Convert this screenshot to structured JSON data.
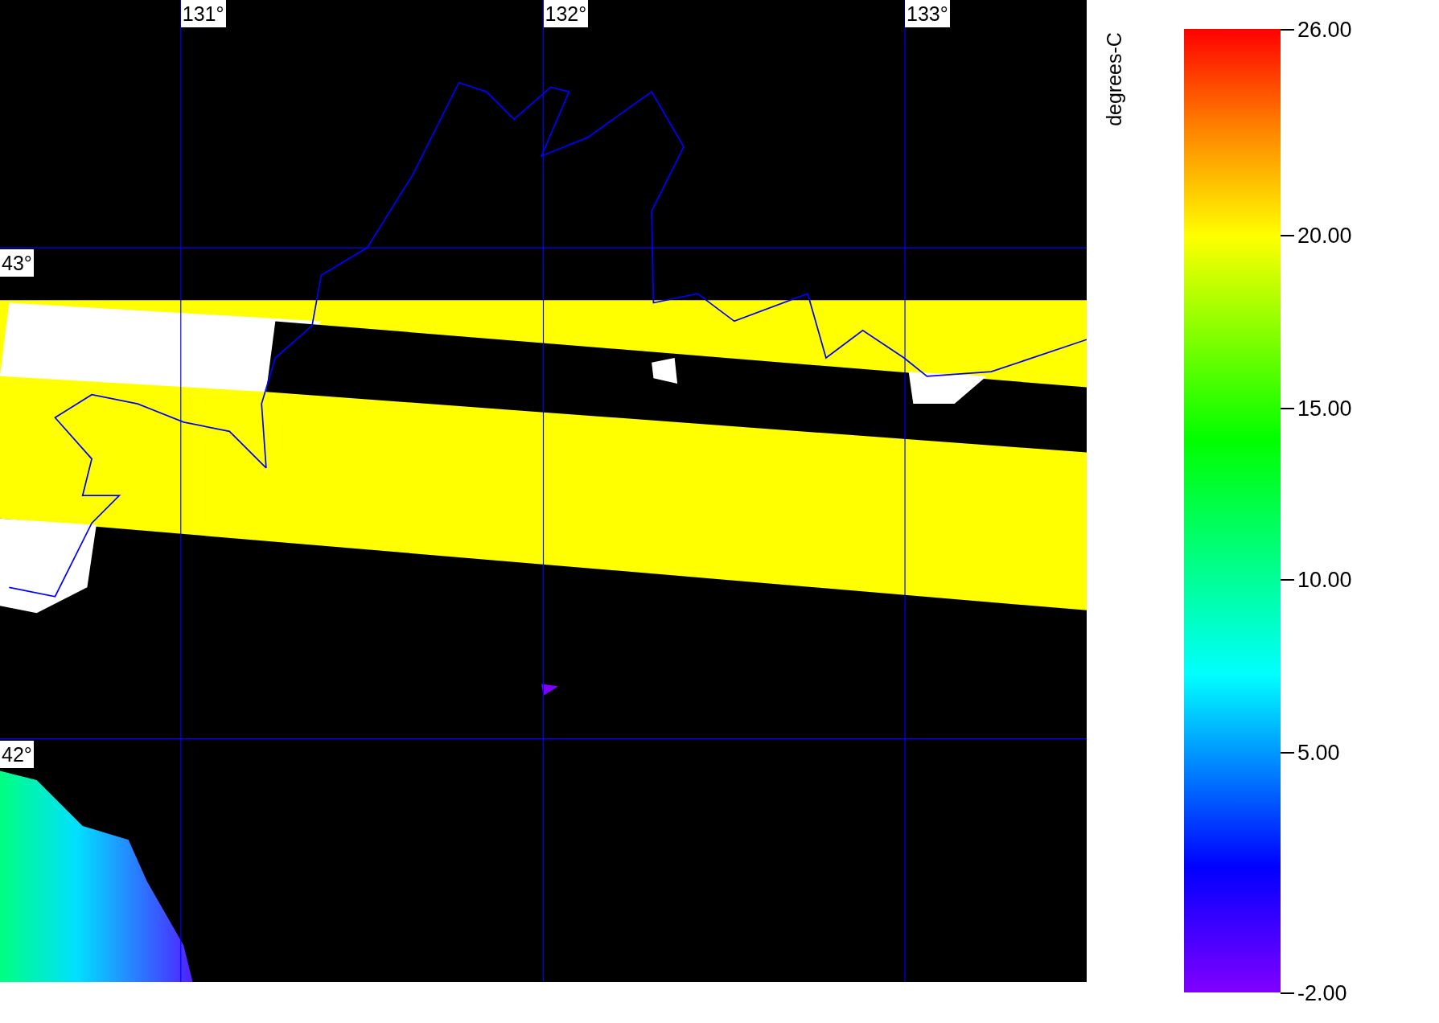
{
  "map": {
    "longitude_labels": [
      "131°",
      "132°",
      "133°"
    ],
    "latitude_labels": [
      "43°",
      "42°"
    ]
  },
  "colorbar": {
    "title": "degrees-C",
    "ticks": [
      "26.00",
      "20.00",
      "15.00",
      "10.00",
      "5.00",
      "-2.00"
    ]
  }
}
